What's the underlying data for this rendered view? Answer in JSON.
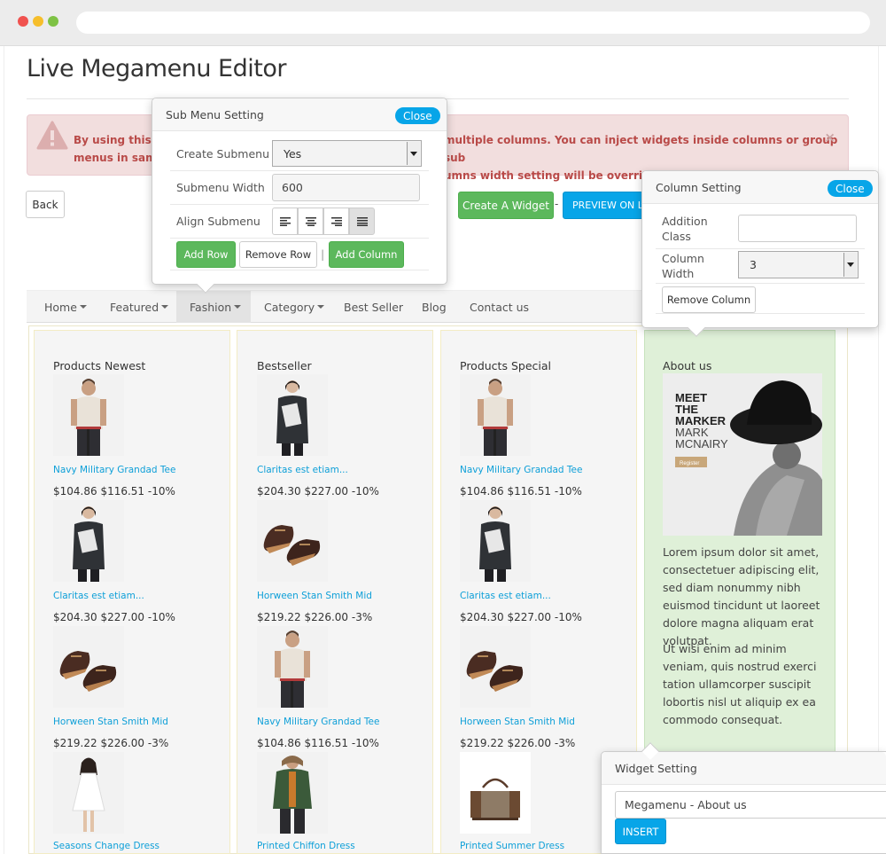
{
  "page_title": "Live Megamenu Editor",
  "alert": {
    "text_left": "By using this to",
    "text_left_line2": "menus in same",
    "text_right": "multiple columns. You can inject widgets inside columns or group sub",
    "text_right_line2": "umns width setting will be overrided",
    "close": "×"
  },
  "toolbar": {
    "back": "Back",
    "create_widget": "Create A Widget",
    "separator": "-",
    "preview": "PREVIEW ON LIV"
  },
  "nav": {
    "items": [
      {
        "label": "Home"
      },
      {
        "label": "Featured"
      },
      {
        "label": "Fashion"
      },
      {
        "label": "Category"
      },
      {
        "label": "Best Seller"
      },
      {
        "label": "Blog"
      },
      {
        "label": "Contact us"
      }
    ]
  },
  "columns": [
    {
      "heading": "Products Newest",
      "products": [
        {
          "name": "Navy Military Grandad Tee",
          "price": "$104.86 $116.51 -10%"
        },
        {
          "name": "Claritas est etiam...",
          "price": "$204.30 $227.00 -10%"
        },
        {
          "name": "Horween Stan Smith Mid",
          "price": "$219.22 $226.00 -3%"
        },
        {
          "name": "Seasons Change Dress",
          "price": ""
        }
      ]
    },
    {
      "heading": "Bestseller",
      "products": [
        {
          "name": "Claritas est etiam...",
          "price": "$204.30 $227.00 -10%"
        },
        {
          "name": "Horween Stan Smith Mid",
          "price": "$219.22 $226.00 -3%"
        },
        {
          "name": "Navy Military Grandad Tee",
          "price": "$104.86 $116.51 -10%"
        },
        {
          "name": "Printed Chiffon Dress",
          "price": ""
        }
      ]
    },
    {
      "heading": "Products Special",
      "products": [
        {
          "name": "Navy Military Grandad Tee",
          "price": "$104.86 $116.51 -10%"
        },
        {
          "name": "Claritas est etiam...",
          "price": "$204.30 $227.00 -10%"
        },
        {
          "name": "Horween Stan Smith Mid",
          "price": "$219.22 $226.00 -3%"
        },
        {
          "name": "Printed Summer Dress",
          "price": ""
        }
      ]
    }
  ],
  "about": {
    "heading": "About us",
    "banner_line1": "MEET",
    "banner_line2": "THE",
    "banner_line3": "MARKER",
    "banner_line4": "MARK",
    "banner_line5": "MCNAIRY",
    "banner_button": "Register",
    "para1": "Lorem ipsum dolor sit amet, consectetuer adipiscing elit, sed diam nonummy nibh euismod tincidunt ut laoreet dolore magna aliquam erat volutpat.",
    "para2": "Ut wisi enim ad minim veniam, quis nostrud exerci tation ullamcorper suscipit lobortis nisl ut aliquip ex ea commodo consequat."
  },
  "submenu_setting": {
    "title": "Sub Menu Setting",
    "close": "Close",
    "create_label": "Create Submenu",
    "create_value": "Yes",
    "width_label": "Submenu Width",
    "width_value": "600",
    "align_label": "Align Submenu",
    "add_row": "Add Row",
    "remove_row": "Remove Row",
    "divider": "|",
    "add_column": "Add Column"
  },
  "column_setting": {
    "title": "Column Setting",
    "close": "Close",
    "class_label": "Addition Class",
    "class_value": "",
    "width_label": "Column Width",
    "width_value": "3",
    "remove_column": "Remove Column"
  },
  "widget_setting": {
    "title": "Widget Setting",
    "selected": "Megamenu - About us",
    "insert": "INSERT"
  },
  "colors": {
    "accent_blue": "#07a5e8",
    "green": "#5cb85c",
    "alert_bg": "#f2dede",
    "about_bg": "#dff0d8"
  }
}
